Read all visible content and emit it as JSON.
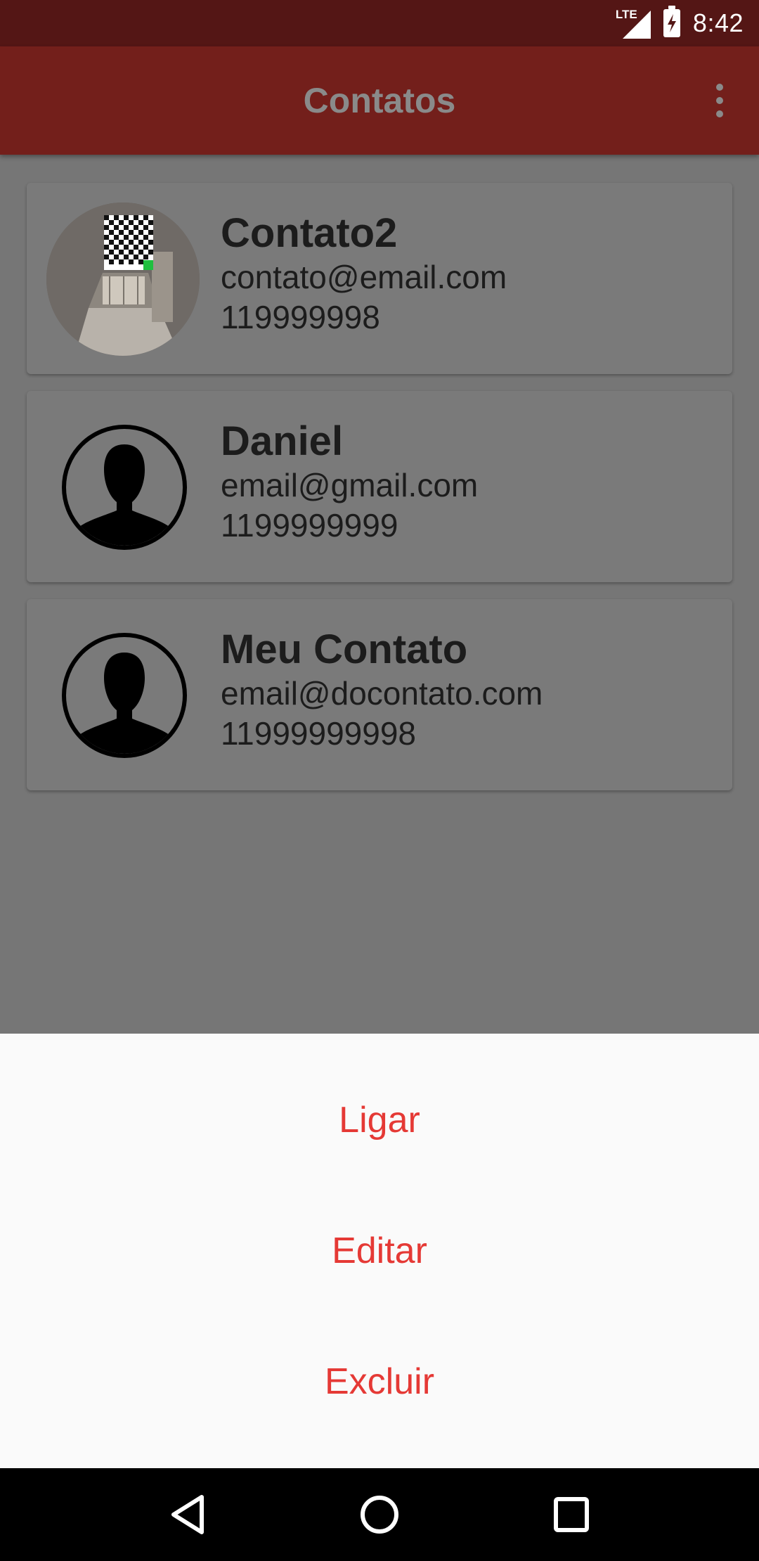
{
  "status_bar": {
    "network": "LTE",
    "time": "8:42"
  },
  "app_bar": {
    "title": "Contatos",
    "menu_icon": "more-vert-icon"
  },
  "contacts": [
    {
      "name": "Contato2",
      "email": "contato@email.com",
      "phone": "119999998",
      "avatar": "photo"
    },
    {
      "name": "Daniel",
      "email": "email@gmail.com",
      "phone": "1199999999",
      "avatar": "default-person-icon"
    },
    {
      "name": "Meu Contato",
      "email": "email@docontato.com",
      "phone": "11999999998",
      "avatar": "default-person-icon"
    }
  ],
  "bottom_sheet": {
    "actions": [
      {
        "label": "Ligar"
      },
      {
        "label": "Editar"
      },
      {
        "label": "Excluir"
      }
    ]
  },
  "nav_bar": {
    "back_icon": "back-triangle-icon",
    "home_icon": "home-circle-icon",
    "recents_icon": "recents-square-icon"
  },
  "colors": {
    "status_bar": "#541615",
    "app_bar": "#731f1b",
    "scrim": "#757575",
    "action_text": "#e53935",
    "sheet_bg": "#fafafa"
  }
}
